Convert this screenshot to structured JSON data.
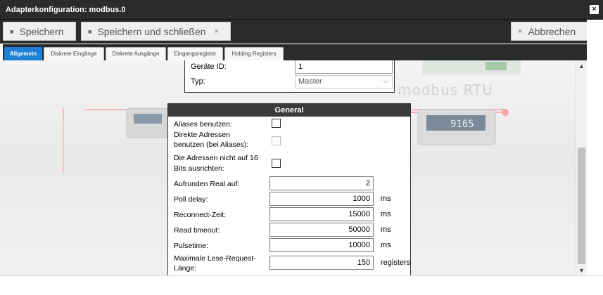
{
  "window": {
    "title": "Adapterkonfiguration: modbus.0"
  },
  "toolbar": {
    "save_label": "Speichern",
    "save_close_label": "Speichern und schließen",
    "cancel_label": "Abbrechen"
  },
  "tabs": [
    {
      "label": "Allgemein",
      "active": true
    },
    {
      "label": "Diskrete Eingänge"
    },
    {
      "label": "Diskrete Ausgänge"
    },
    {
      "label": "Eingangsregister"
    },
    {
      "label": "Holding Registers"
    }
  ],
  "background": {
    "watermark_text": "modbus RTU"
  },
  "device": {
    "device_id_label": "Geräte ID:",
    "device_id_value": "1",
    "type_label": "Typ:",
    "type_value": "Master"
  },
  "general": {
    "header": "General",
    "aliases_label": "Aliases benutzen:",
    "direct_label_1": "Direkte Adressen",
    "direct_label_2": "benutzen (bei Aliases):",
    "align_label_1": "Die Adressen nicht auf 16",
    "align_label_2": "Bits ausrichten:",
    "round_label": "Aufrunden Real auf:",
    "round_value": "2",
    "poll_label": "Poll delay:",
    "poll_value": "1000",
    "poll_unit": "ms",
    "reconnect_label": "Reconnect-Zeit:",
    "reconnect_value": "15000",
    "reconnect_unit": "ms",
    "timeout_label": "Read timeout:",
    "timeout_value": "50000",
    "timeout_unit": "ms",
    "pulse_label": "Pulsetime:",
    "pulse_value": "10000",
    "pulse_unit": "ms",
    "maxlen_label_1": "Maximale Lese-Request-",
    "maxlen_label_2": "Länge:",
    "maxlen_value": "150",
    "maxlen_unit": "registers"
  },
  "colors": {
    "accent": "#1e80d6",
    "chrome": "#2b2b2b"
  }
}
